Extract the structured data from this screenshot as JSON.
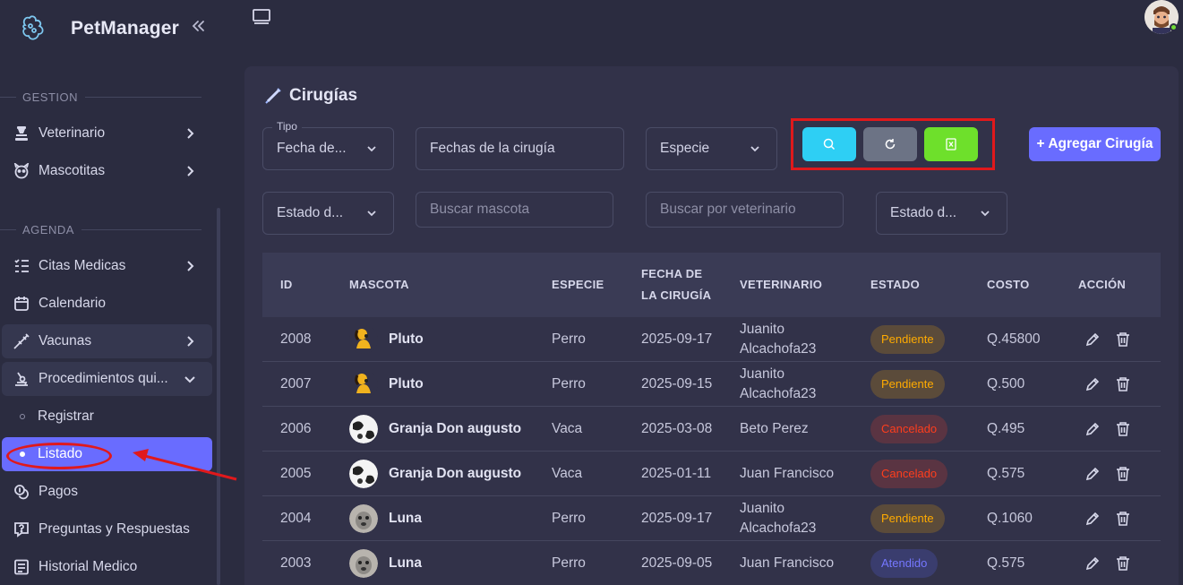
{
  "brand": {
    "name": "PetManager"
  },
  "sidebar": {
    "sections": [
      {
        "label": "GESTION"
      },
      {
        "label": "AGENDA"
      }
    ],
    "items": [
      {
        "label": "Veterinario",
        "icon": "vet-icon"
      },
      {
        "label": "Mascotitas",
        "icon": "pet-face-icon"
      },
      {
        "label": "Citas Medicas",
        "icon": "list-check-icon"
      },
      {
        "label": "Calendario",
        "icon": "calendar-icon"
      },
      {
        "label": "Vacunas",
        "icon": "syringe-icon"
      },
      {
        "label": "Procedimientos qui...",
        "icon": "procedure-icon"
      },
      {
        "label": "Registrar"
      },
      {
        "label": "Listado"
      },
      {
        "label": "Pagos",
        "icon": "coins-icon"
      },
      {
        "label": "Preguntas y Respuestas",
        "icon": "question-icon"
      },
      {
        "label": "Historial Medico",
        "icon": "history-icon"
      }
    ]
  },
  "page": {
    "title": "Cirugías"
  },
  "filters": {
    "tipo_legend": "Tipo",
    "tipo_value": "Fecha de...",
    "fechas_value": "Fechas de la cirugía",
    "especie_value": "Especie",
    "estado1_value": "Estado d...",
    "buscar_mascota_placeholder": "Buscar mascota",
    "buscar_vet_placeholder": "Buscar por veterinario",
    "estado2_value": "Estado d..."
  },
  "buttons": {
    "add_label": "+ Agregar Cirugía",
    "search_color": "#2ecff4",
    "refresh_color": "#6c7385",
    "excel_color": "#6ee02b"
  },
  "table": {
    "headers": [
      "ID",
      "MASCOTA",
      "ESPECIE",
      "FECHA DE LA CIRUGÍA",
      "VETERINARIO",
      "ESTADO",
      "COSTO",
      "ACCIÓN"
    ],
    "rows": [
      {
        "id": "2008",
        "mascota": "Pluto",
        "especie": "Perro",
        "fecha": "2025-09-17",
        "veterinario": "Juanito Alcachofa23",
        "estado": "Pendiente",
        "costo": "Q.45800"
      },
      {
        "id": "2007",
        "mascota": "Pluto",
        "especie": "Perro",
        "fecha": "2025-09-15",
        "veterinario": "Juanito Alcachofa23",
        "estado": "Pendiente",
        "costo": "Q.500"
      },
      {
        "id": "2006",
        "mascota": "Granja Don augusto",
        "especie": "Vaca",
        "fecha": "2025-03-08",
        "veterinario": "Beto Perez",
        "estado": "Cancelado",
        "costo": "Q.495"
      },
      {
        "id": "2005",
        "mascota": "Granja Don augusto",
        "especie": "Vaca",
        "fecha": "2025-01-11",
        "veterinario": "Juan Francisco",
        "estado": "Cancelado",
        "costo": "Q.575"
      },
      {
        "id": "2004",
        "mascota": "Luna",
        "especie": "Perro",
        "fecha": "2025-09-17",
        "veterinario": "Juanito Alcachofa23",
        "estado": "Pendiente",
        "costo": "Q.1060"
      },
      {
        "id": "2003",
        "mascota": "Luna",
        "especie": "Perro",
        "fecha": "2025-09-05",
        "veterinario": "Juan Francisco",
        "estado": "Atendido",
        "costo": "Q.575"
      }
    ]
  }
}
